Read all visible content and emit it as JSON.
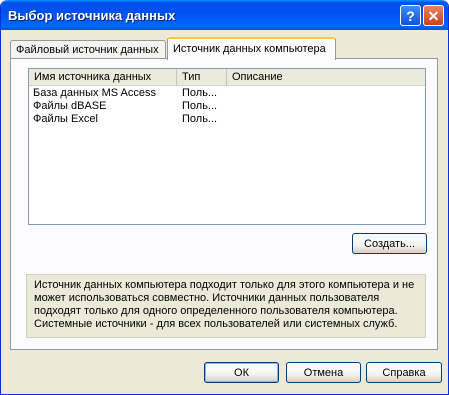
{
  "window": {
    "title": "Выбор источника данных",
    "help_glyph": "?",
    "close_glyph": "✕"
  },
  "tabs": [
    {
      "label": "Файловый источник данных",
      "selected": false
    },
    {
      "label": "Источник данных компьютера",
      "selected": true
    }
  ],
  "list": {
    "columns": [
      "Имя источника данных",
      "Тип",
      "Описание"
    ],
    "rows": [
      {
        "name": "База данных MS Access",
        "type": "Поль...",
        "description": ""
      },
      {
        "name": "Файлы dBASE",
        "type": "Поль...",
        "description": ""
      },
      {
        "name": "Файлы Excel",
        "type": "Поль...",
        "description": ""
      }
    ]
  },
  "create_button": "Создать...",
  "info_lines": [
    "Источник данных компьютера подходит только для этого компьютера и не",
    "может использоваться совместно.  Источники данных пользователя",
    "подходят только для одного определенного пользователя компьютера.",
    "Системные источники - для всех пользователей или системных служб."
  ],
  "buttons": {
    "ok": "ОК",
    "cancel": "Отмена",
    "help": "Справка"
  },
  "colors": {
    "titlebar": "#0054e3",
    "face": "#ece9d8",
    "active_tab_accent": "#ffc83c"
  }
}
